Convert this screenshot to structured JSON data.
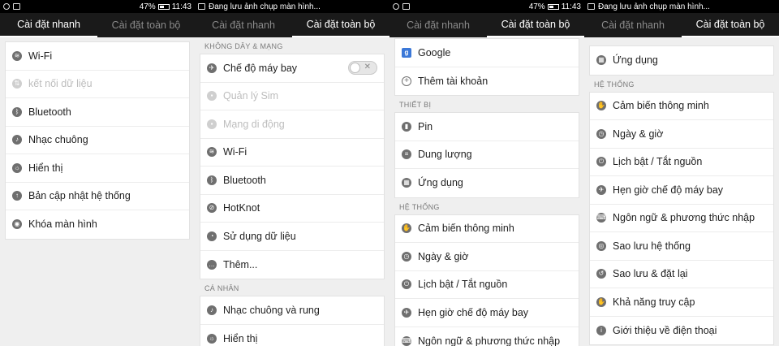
{
  "panels": [
    {
      "status": {
        "left_text": "",
        "battery": "47%",
        "time": "11:43"
      },
      "tabs": [
        "Cài đặt nhanh",
        "Cài đặt toàn bộ"
      ],
      "active_tab": 0,
      "items": [
        {
          "label": "Wi-Fi",
          "icon": "wifi-icon"
        },
        {
          "label": "kết nối dữ liệu",
          "icon": "data-connection-icon",
          "disabled": true
        },
        {
          "label": "Bluetooth",
          "icon": "bluetooth-icon"
        },
        {
          "label": "Nhạc chuông",
          "icon": "volume-icon"
        },
        {
          "label": "Hiển thị",
          "icon": "display-icon"
        },
        {
          "label": "Bản cập nhật hệ thống",
          "icon": "system-update-icon"
        },
        {
          "label": "Khóa màn hình",
          "icon": "lock-screen-icon"
        }
      ]
    },
    {
      "status": {
        "left_text": "Đang lưu ảnh chụp màn hình...",
        "battery": "",
        "time": ""
      },
      "tabs": [
        "Cài đặt nhanh",
        "Cài đặt toàn bộ"
      ],
      "active_tab": 1,
      "sections": [
        {
          "title": "KHÔNG DÂY & MẠNG"
        },
        {
          "title": "CÁ NHÂN"
        }
      ],
      "items_wireless": [
        {
          "label": "Chế độ máy bay",
          "icon": "airplane-icon",
          "toggle": true
        },
        {
          "label": "Quản lý Sim",
          "icon": "sim-icon",
          "disabled": true
        },
        {
          "label": "Mạng di động",
          "icon": "mobile-network-icon",
          "disabled": true
        },
        {
          "label": "Wi-Fi",
          "icon": "wifi-icon"
        },
        {
          "label": "Bluetooth",
          "icon": "bluetooth-icon"
        },
        {
          "label": "HotKnot",
          "icon": "hotknot-icon"
        },
        {
          "label": "Sử dụng dữ liệu",
          "icon": "data-usage-icon"
        },
        {
          "label": "Thêm...",
          "icon": "more-icon"
        }
      ],
      "items_personal": [
        {
          "label": "Nhạc chuông và rung",
          "icon": "volume-icon"
        },
        {
          "label": "Hiển thị",
          "icon": "display-icon"
        }
      ]
    },
    {
      "status": {
        "left_text": "",
        "battery": "47%",
        "time": "11:43"
      },
      "tabs": [
        "Cài đặt nhanh",
        "Cài đặt toàn bộ"
      ],
      "active_tab": 1,
      "sections": [
        {
          "title": "THIẾT BỊ"
        },
        {
          "title": "HỆ THỐNG"
        }
      ],
      "items_accounts": [
        {
          "label": "Google",
          "icon": "google-icon"
        },
        {
          "label": "Thêm tài khoản",
          "icon": "add-account-icon"
        }
      ],
      "items_device": [
        {
          "label": "Pin",
          "icon": "battery-icon"
        },
        {
          "label": "Dung lượng",
          "icon": "storage-icon"
        },
        {
          "label": "Ứng dụng",
          "icon": "apps-icon"
        }
      ],
      "items_system": [
        {
          "label": "Cảm biến thông minh",
          "icon": "smart-sensor-icon"
        },
        {
          "label": "Ngày & giờ",
          "icon": "clock-icon"
        },
        {
          "label": "Lịch bật / Tắt nguồn",
          "icon": "power-schedule-icon"
        },
        {
          "label": "Hẹn giờ chế độ máy bay",
          "icon": "airplane-schedule-icon"
        },
        {
          "label": "Ngôn ngữ & phương thức nhập",
          "icon": "language-input-icon"
        }
      ]
    },
    {
      "status": {
        "left_text": "Đang lưu ảnh chụp màn hình...",
        "battery": "",
        "time": ""
      },
      "tabs": [
        "Cài đặt nhanh",
        "Cài đặt toàn bộ"
      ],
      "active_tab": 1,
      "sections": [
        {
          "title": "HỆ THỐNG"
        }
      ],
      "items_top": [
        {
          "label": "Ứng dụng",
          "icon": "apps-icon"
        }
      ],
      "items_system": [
        {
          "label": "Cảm biến thông minh",
          "icon": "smart-sensor-icon"
        },
        {
          "label": "Ngày & giờ",
          "icon": "clock-icon"
        },
        {
          "label": "Lịch bật / Tắt nguồn",
          "icon": "power-schedule-icon"
        },
        {
          "label": "Hẹn giờ chế độ máy bay",
          "icon": "airplane-schedule-icon"
        },
        {
          "label": "Ngôn ngữ & phương thức nhập",
          "icon": "language-input-icon"
        },
        {
          "label": "Sao lưu hệ thống",
          "icon": "system-backup-icon"
        },
        {
          "label": "Sao lưu & đặt lại",
          "icon": "backup-reset-icon"
        },
        {
          "label": "Khả năng truy cập",
          "icon": "accessibility-icon"
        },
        {
          "label": "Giới thiệu về điện thoại",
          "icon": "about-phone-icon"
        }
      ]
    }
  ]
}
